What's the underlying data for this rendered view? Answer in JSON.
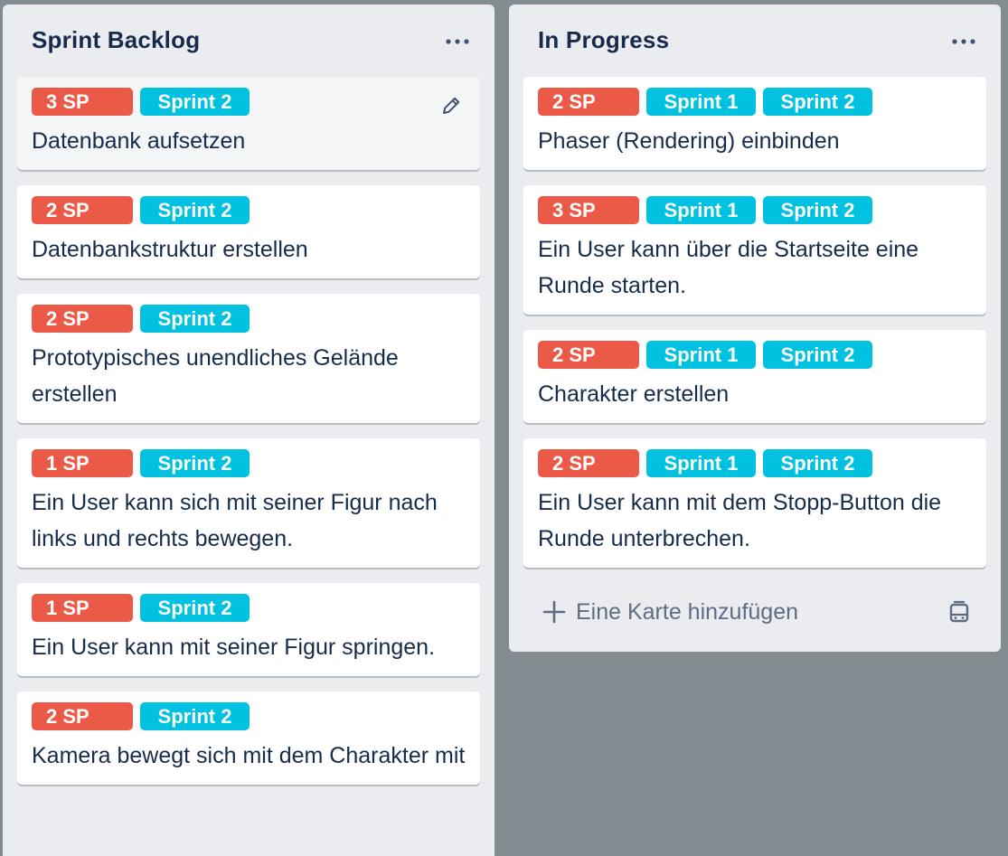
{
  "colors": {
    "board_bg": "#838c91",
    "list_bg": "#ebecf0",
    "label_red": "#eb5a46",
    "label_cyan": "#00c2e0",
    "text_dark": "#172b4d",
    "text_muted": "#5e6c84"
  },
  "lists": [
    {
      "title": "Sprint Backlog",
      "menu_icon": "more-horizontal-icon",
      "cards": [
        {
          "labels": [
            "3 SP",
            "Sprint 2"
          ],
          "title": "Datenbank aufsetzen",
          "edit_icon": "pencil-icon"
        },
        {
          "labels": [
            "2 SP",
            "Sprint 2"
          ],
          "title": "Datenbankstruktur erstellen"
        },
        {
          "labels": [
            "2 SP",
            "Sprint 2"
          ],
          "title": "Prototypisches unendliches Gelände erstellen"
        },
        {
          "labels": [
            "1 SP",
            "Sprint 2"
          ],
          "title": "Ein User kann sich mit seiner Figur nach links und rechts bewegen."
        },
        {
          "labels": [
            "1 SP",
            "Sprint 2"
          ],
          "title": "Ein User kann mit seiner Figur springen."
        },
        {
          "labels": [
            "2 SP",
            "Sprint 2"
          ],
          "title": "Kamera bewegt sich mit dem Charakter mit"
        }
      ]
    },
    {
      "title": "In Progress",
      "menu_icon": "more-horizontal-icon",
      "cards": [
        {
          "labels": [
            "2 SP",
            "Sprint 1",
            "Sprint 2"
          ],
          "title": "Phaser (Rendering) einbinden"
        },
        {
          "labels": [
            "3 SP",
            "Sprint 1",
            "Sprint 2"
          ],
          "title": "Ein User kann über die Startseite eine Runde starten."
        },
        {
          "labels": [
            "2 SP",
            "Sprint 1",
            "Sprint 2"
          ],
          "title": "Charakter erstellen"
        },
        {
          "labels": [
            "2 SP",
            "Sprint 1",
            "Sprint 2"
          ],
          "title": "Ein User kann mit dem Stopp-Button die Runde unterbrechen."
        }
      ],
      "add_card_label": "Eine Karte hinzufügen",
      "add_icon": "plus-icon",
      "template_icon": "card-template-icon"
    }
  ]
}
